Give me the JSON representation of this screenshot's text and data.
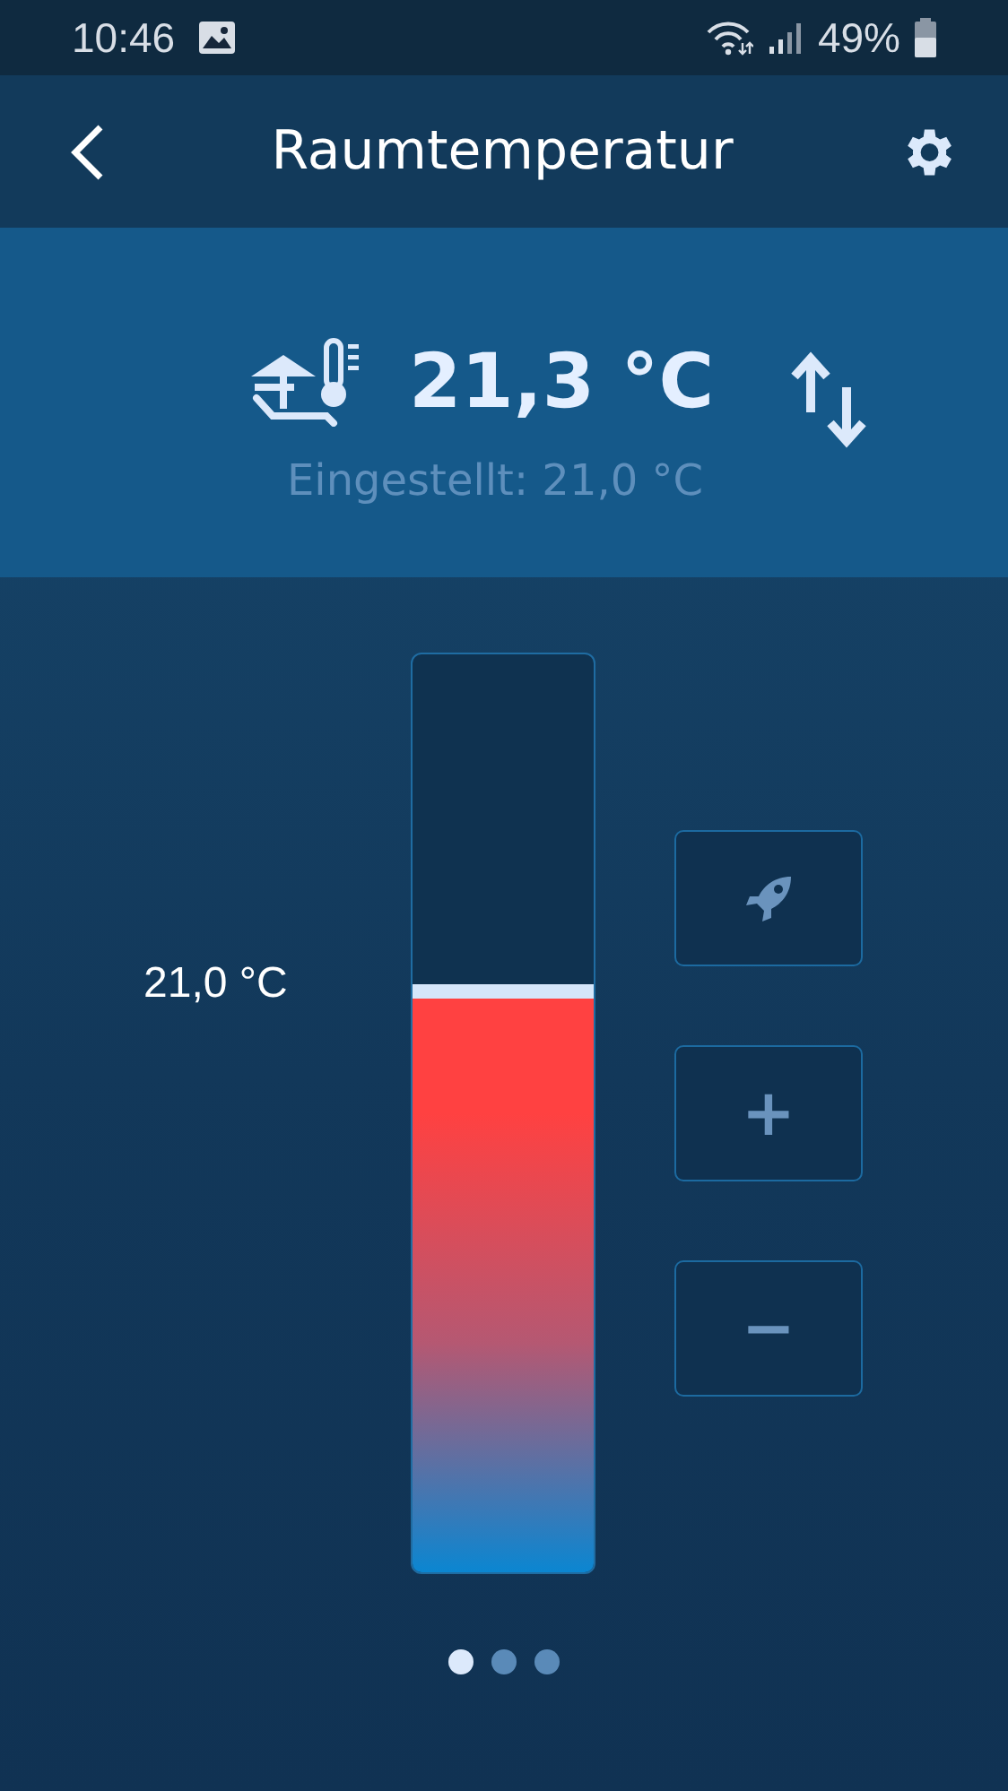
{
  "status_bar": {
    "time": "10:46",
    "battery": "49%"
  },
  "header": {
    "title": "Raumtemperatur"
  },
  "current": {
    "temperature": "21,3 °C",
    "setpoint_text": "Eingestellt: 21,0 °C"
  },
  "gauge": {
    "label": "21,0 °C",
    "level": 0.64
  },
  "buttons": [
    {
      "kind": "boost"
    },
    {
      "kind": "text",
      "label": "+"
    },
    {
      "kind": "text",
      "label": "−"
    }
  ],
  "pages": [
    {
      "selected": true
    },
    {
      "selected": false
    },
    {
      "selected": false
    }
  ]
}
